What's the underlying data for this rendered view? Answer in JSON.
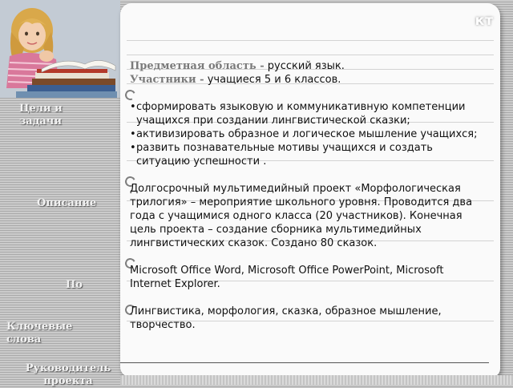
{
  "header": {
    "corner_title": "кт"
  },
  "sidebar": {
    "goals_label": "Цели и задачи",
    "description_label": "Описание",
    "software_label": "По",
    "keywords_label": "Ключевые слова",
    "leader_label": "Руководитель проекта"
  },
  "main": {
    "subject_key": "Предметная область -",
    "subject_value": "русский язык.",
    "participants_key": "Участники -",
    "participants_value": "учащиеся 5 и 6 классов.",
    "goals": [
      "сформировать языковую и коммуникативную компетенции учащихся  при создании лингвистической сказки;",
      "активизировать образное и логическое мышление учащихся;",
      "развить познавательные мотивы учащихся  и создать ситуацию успешности ."
    ],
    "description": "Долгосрочный мультимедийный проект «Морфологическая трилогия» – мероприятие школьного уровня. Проводится два года с учащимися одного класса (20 участников). Конечная цель проекта – создание сборника мультимедийных лингвистических сказок. Создано 80 сказок.",
    "software": "Microsoft Office Word, Microsoft Office PowerPoint, Microsoft Internet Explorer.",
    "keywords": "Лингвистика, морфология, сказка, образное мышление, творчество."
  }
}
